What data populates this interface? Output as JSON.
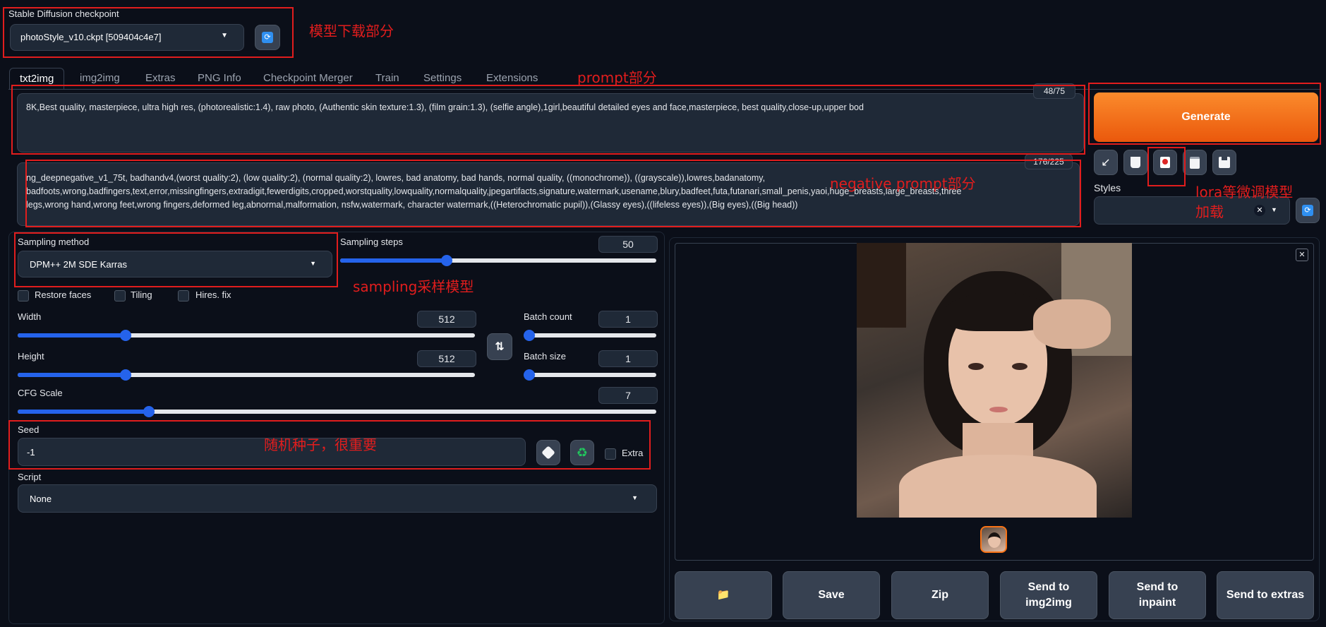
{
  "checkpoint": {
    "label": "Stable Diffusion checkpoint",
    "value": "photoStyle_v10.ckpt [509404c4e7]"
  },
  "tabs": [
    "txt2img",
    "img2img",
    "Extras",
    "PNG Info",
    "Checkpoint Merger",
    "Train",
    "Settings",
    "Extensions"
  ],
  "prompt": {
    "text": "8K,Best quality, masterpiece, ultra high res, (photorealistic:1.4), raw photo, (Authentic skin texture:1.3), (film grain:1.3), (selfie angle),1girl,beautiful detailed eyes and face,masterpiece, best quality,close-up,upper bod",
    "counter": "48/75"
  },
  "negative_prompt": {
    "line1": "ng_deepnegative_v1_75t, badhandv4,(worst quality:2), (low quality:2), (normal quality:2), lowres, bad anatomy, bad hands, normal quality, ((monochrome)), ((grayscale)),lowres,badanatomy,",
    "line2": "badfoots,wrong,badfingers,text,error,missingfingers,extradigit,fewerdigits,cropped,worstquality,lowquality,normalquality,jpegartifacts,signature,watermark,usename,blury,badfeet,futa,futanari,small_penis,yaoi,huge_breasts,large_breasts,three",
    "line3": "legs,wrong hand,wrong feet,wrong fingers,deformed leg,abnormal,malformation, nsfw,watermark, character watermark,((Heterochromatic pupil)),(Glassy eyes),((lifeless eyes)),(Big eyes),((Big head))",
    "counter": "176/225"
  },
  "generate_label": "Generate",
  "styles_label": "Styles",
  "sampling": {
    "method_label": "Sampling method",
    "method_value": "DPM++ 2M SDE Karras",
    "steps_label": "Sampling steps",
    "steps_value": "50",
    "steps_fraction": 0.33
  },
  "checkboxes": {
    "restore_faces": "Restore faces",
    "tiling": "Tiling",
    "hires_fix": "Hires. fix"
  },
  "width": {
    "label": "Width",
    "value": "512",
    "fraction": 0.23
  },
  "height": {
    "label": "Height",
    "value": "512",
    "fraction": 0.23
  },
  "batch_count": {
    "label": "Batch count",
    "value": "1",
    "fraction": 0.0
  },
  "batch_size": {
    "label": "Batch size",
    "value": "1",
    "fraction": 0.0
  },
  "cfg": {
    "label": "CFG Scale",
    "value": "7",
    "fraction": 0.2
  },
  "seed": {
    "label": "Seed",
    "value": "-1",
    "extra_label": "Extra"
  },
  "script": {
    "label": "Script",
    "value": "None"
  },
  "output_buttons": {
    "folder": "📁",
    "save": "Save",
    "zip": "Zip",
    "send_img2img_1": "Send to",
    "send_img2img_2": "img2img",
    "send_inpaint_1": "Send to",
    "send_inpaint_2": "inpaint",
    "send_extras": "Send to extras"
  },
  "annotations": {
    "model_download": "模型下载部分",
    "prompt_part": "prompt部分",
    "negative_prompt_part": "negative prompt部分",
    "lora_1": "lora等微调模型",
    "lora_2": "加载",
    "sampling_model": "sampling采样模型",
    "seed_note": "随机种子，很重要"
  },
  "colors": {
    "accent": "#2563eb",
    "generate": "#f97316",
    "annotation": "#e11d1d",
    "background": "#0b0f19"
  }
}
